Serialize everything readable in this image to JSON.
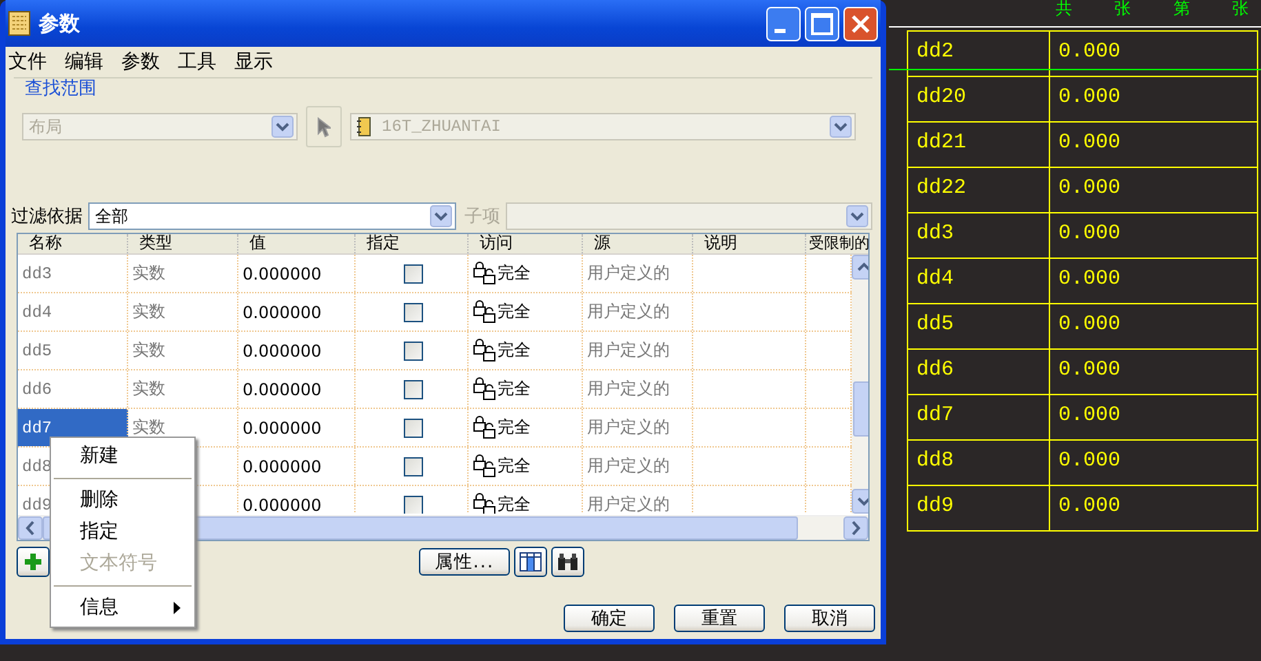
{
  "window": {
    "title": "参数"
  },
  "menu": [
    "文件",
    "编辑",
    "参数",
    "工具",
    "显示"
  ],
  "look_in": {
    "legend": "查找范围",
    "type_value": "布局",
    "object_value": "16T_ZHUANTAI",
    "disabled": true
  },
  "filter": {
    "label": "过滤依据",
    "value": "全部",
    "sub_label": "子项"
  },
  "table": {
    "columns": [
      "名称",
      "类型",
      "值",
      "指定",
      "访问",
      "源",
      "说明",
      "受限制的"
    ],
    "rows": [
      {
        "name": "dd3",
        "type": "实数",
        "value": "0.000000",
        "designated": false,
        "access": "完全",
        "source": "用户定义的",
        "selected": false
      },
      {
        "name": "dd4",
        "type": "实数",
        "value": "0.000000",
        "designated": false,
        "access": "完全",
        "source": "用户定义的",
        "selected": false
      },
      {
        "name": "dd5",
        "type": "实数",
        "value": "0.000000",
        "designated": false,
        "access": "完全",
        "source": "用户定义的",
        "selected": false
      },
      {
        "name": "dd6",
        "type": "实数",
        "value": "0.000000",
        "designated": false,
        "access": "完全",
        "source": "用户定义的",
        "selected": false
      },
      {
        "name": "dd7",
        "type": "实数",
        "value": "0.000000",
        "designated": false,
        "access": "完全",
        "source": "用户定义的",
        "selected": true
      },
      {
        "name": "dd8",
        "value": "0.000000",
        "designated": false,
        "access": "完全",
        "source": "用户定义的",
        "selected": false
      },
      {
        "name": "dd9",
        "value": "0.000000",
        "designated": false,
        "access": "完全",
        "source": "用户定义的",
        "selected": false
      }
    ]
  },
  "context_menu": [
    {
      "kind": "item",
      "label": "新建",
      "disabled": false
    },
    {
      "kind": "separator"
    },
    {
      "kind": "item",
      "label": "删除",
      "disabled": false
    },
    {
      "kind": "item",
      "label": "指定",
      "disabled": false
    },
    {
      "kind": "item",
      "label": "文本符号",
      "disabled": true
    },
    {
      "kind": "separator"
    },
    {
      "kind": "submenu",
      "label": "信息",
      "disabled": false
    }
  ],
  "properties_button": "属性...",
  "footer_buttons": [
    "确定",
    "重置",
    "取消"
  ],
  "drawing_table": {
    "header": [
      "共",
      "张",
      "第",
      "张"
    ],
    "rows": [
      {
        "name": "dd2",
        "value": "0.000"
      },
      {
        "name": "dd20",
        "value": "0.000"
      },
      {
        "name": "dd21",
        "value": "0.000"
      },
      {
        "name": "dd22",
        "value": "0.000"
      },
      {
        "name": "dd3",
        "value": "0.000"
      },
      {
        "name": "dd4",
        "value": "0.000"
      },
      {
        "name": "dd5",
        "value": "0.000"
      },
      {
        "name": "dd6",
        "value": "0.000"
      },
      {
        "name": "dd7",
        "value": "0.000"
      },
      {
        "name": "dd8",
        "value": "0.000"
      },
      {
        "name": "dd9",
        "value": "0.000"
      }
    ]
  }
}
